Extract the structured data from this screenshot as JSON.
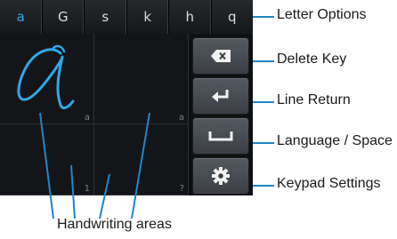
{
  "letter_options": [
    "a",
    "G",
    "s",
    "k",
    "h",
    "q"
  ],
  "handwriting": {
    "area_marks": [
      "a",
      "a",
      "1",
      "?"
    ]
  },
  "callouts": {
    "letter_options": "Letter Options",
    "delete_key": "Delete Key",
    "line_return": "Line Return",
    "language_space": "Language / Space",
    "keypad_settings": "Keypad Settings",
    "handwriting_areas": "Handwriting areas"
  },
  "colors": {
    "accent": "#2ea8e8",
    "callout_line": "#1e86c9",
    "pad_background": "#111214"
  },
  "icons": {
    "delete": "backspace-icon",
    "enter": "enter-icon",
    "space": "space-icon",
    "settings": "gear-icon"
  }
}
